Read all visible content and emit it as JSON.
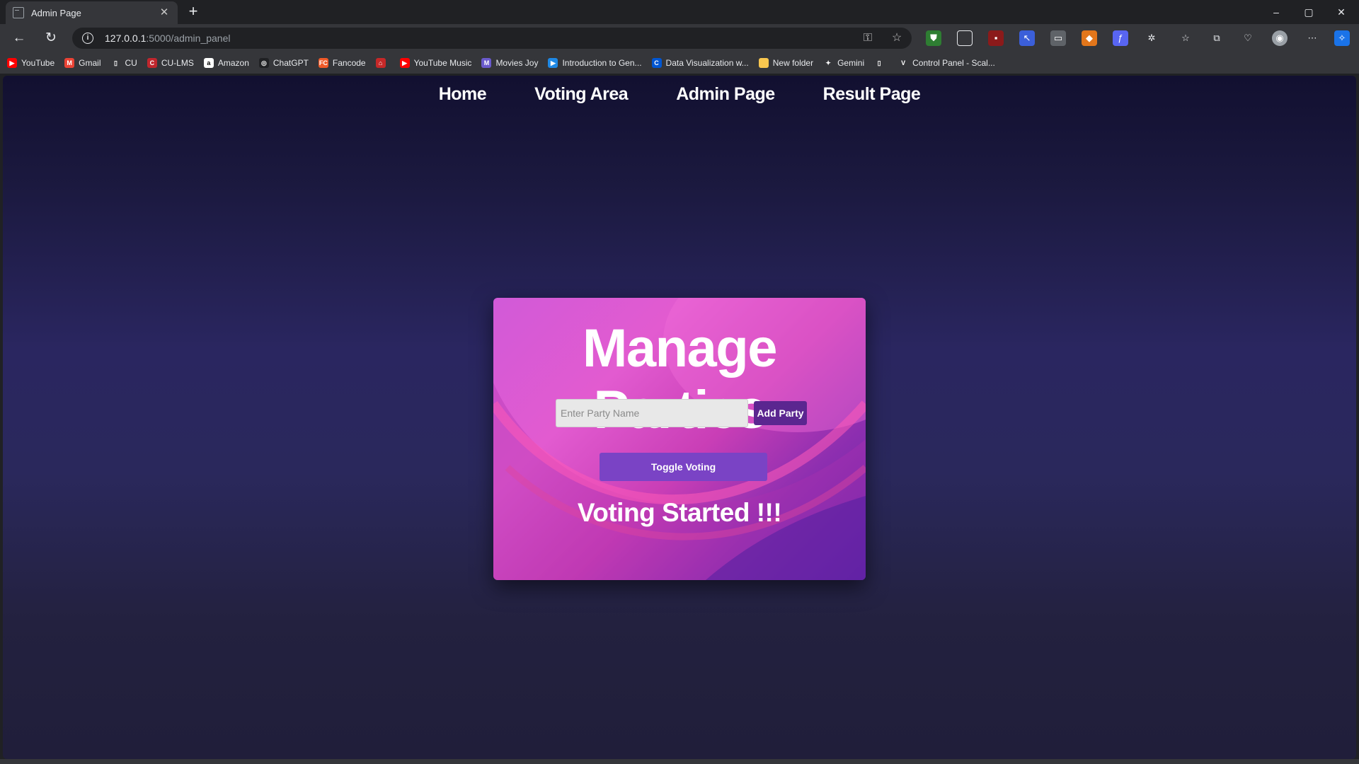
{
  "browser": {
    "tab_title": "Admin Page",
    "tab_close": "✕",
    "new_tab": "+",
    "url_host": "127.0.0.1",
    "url_path": ":5000/admin_panel",
    "window_controls": [
      "–",
      "▢",
      "✕"
    ],
    "bookmarks": [
      {
        "label": "YouTube",
        "icon": "youtube-icon",
        "color": "#ff0000",
        "glyph": "▶"
      },
      {
        "label": "Gmail",
        "icon": "gmail-icon",
        "color": "#ea4335",
        "glyph": "M"
      },
      {
        "label": "CU",
        "icon": "page-icon",
        "color": "#35363a",
        "glyph": "▯"
      },
      {
        "label": "CU-LMS",
        "icon": "cu-lms-icon",
        "color": "#c0262d",
        "glyph": "C"
      },
      {
        "label": "Amazon",
        "icon": "amazon-icon",
        "color": "#ffffff",
        "glyph": "a"
      },
      {
        "label": "ChatGPT",
        "icon": "chatgpt-icon",
        "color": "#202124",
        "glyph": "◎"
      },
      {
        "label": "Fancode",
        "icon": "fancode-icon",
        "color": "#f05a28",
        "glyph": "FC"
      },
      {
        "label": "",
        "icon": "red-logo-icon",
        "color": "#c62828",
        "glyph": "⌂"
      },
      {
        "label": "YouTube Music",
        "icon": "youtube-music-icon",
        "color": "#ff0000",
        "glyph": "▶"
      },
      {
        "label": "Movies Joy",
        "icon": "movies-joy-icon",
        "color": "#6a5acd",
        "glyph": "M"
      },
      {
        "label": "Introduction to Gen...",
        "icon": "video-icon",
        "color": "#1e88e5",
        "glyph": "▶"
      },
      {
        "label": "Data Visualization w...",
        "icon": "coursera-icon",
        "color": "#0056d2",
        "glyph": "C"
      },
      {
        "label": "New folder",
        "icon": "folder-icon",
        "color": "#f9c74f",
        "glyph": ""
      },
      {
        "label": "Gemini",
        "icon": "gemini-icon",
        "color": "#35363a",
        "glyph": "✦"
      },
      {
        "label": "",
        "icon": "page-icon",
        "color": "#35363a",
        "glyph": "▯"
      },
      {
        "label": "Control Panel - Scal...",
        "icon": "control-panel-icon",
        "color": "#35363a",
        "glyph": "V"
      }
    ]
  },
  "site_nav": [
    "Home",
    "Voting Area",
    "Admin Page",
    "Result Page"
  ],
  "card": {
    "title": "Manage Parties",
    "input_placeholder": "Enter Party Name",
    "add_button": "Add Party",
    "toggle_button": "Toggle Voting",
    "status": "Voting Started !!!"
  }
}
